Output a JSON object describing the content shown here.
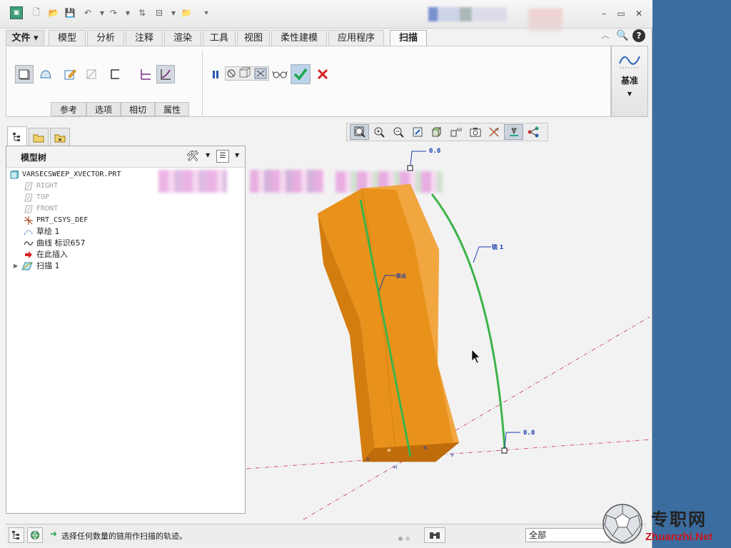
{
  "colors": {
    "accent": "#3c6da0",
    "part": "#e8921c",
    "trajectory": "#3db34a",
    "confirm": "#19a64a",
    "cancel": "#d42020",
    "datum_plane": "#cc3355"
  },
  "menu": {
    "items": [
      {
        "label": "文件 ▾",
        "icon": "chevron-down-icon"
      },
      {
        "label": "模型"
      },
      {
        "label": "分析"
      },
      {
        "label": "注释"
      },
      {
        "label": "渲染"
      },
      {
        "label": "工具"
      },
      {
        "label": "视图"
      },
      {
        "label": "柔性建模"
      },
      {
        "label": "应用程序"
      },
      {
        "label": "扫描",
        "active": true
      }
    ]
  },
  "ribbon": {
    "subtabs": [
      "参考",
      "选项",
      "相切",
      "属性"
    ],
    "datum_label": "基准"
  },
  "model_tree": {
    "title": "模型树",
    "items": [
      {
        "label": "VARSECSWEEP_XVECTOR.PRT",
        "icon": "part-icon"
      },
      {
        "label": "RIGHT",
        "icon": "datum-plane-icon",
        "dim": true
      },
      {
        "label": "TOP",
        "icon": "datum-plane-icon",
        "dim": true
      },
      {
        "label": "FRONT",
        "icon": "datum-plane-icon",
        "dim": true
      },
      {
        "label": "PRT_CSYS_DEF",
        "icon": "csys-icon"
      },
      {
        "label": "草绘 1",
        "icon": "sketch-icon"
      },
      {
        "label": "曲线 标识657",
        "icon": "curve-icon"
      },
      {
        "label": "在此插入",
        "icon": "insert-arrow-icon"
      },
      {
        "label": "扫描 1",
        "icon": "sweep-icon"
      }
    ]
  },
  "viewport": {
    "labels": {
      "top_value": "0.0",
      "bottom_value": "0.0",
      "chain_label": "链 1",
      "origin_label": "原点",
      "n_mark": "N",
      "v_mark": "V",
      "h_mark": "H"
    }
  },
  "status": {
    "message": "选择任何数量的链用作扫描的轨迹。",
    "filter": "全部"
  },
  "watermark": {
    "title": "专职网",
    "url": "Zhuanzhi.Net"
  }
}
